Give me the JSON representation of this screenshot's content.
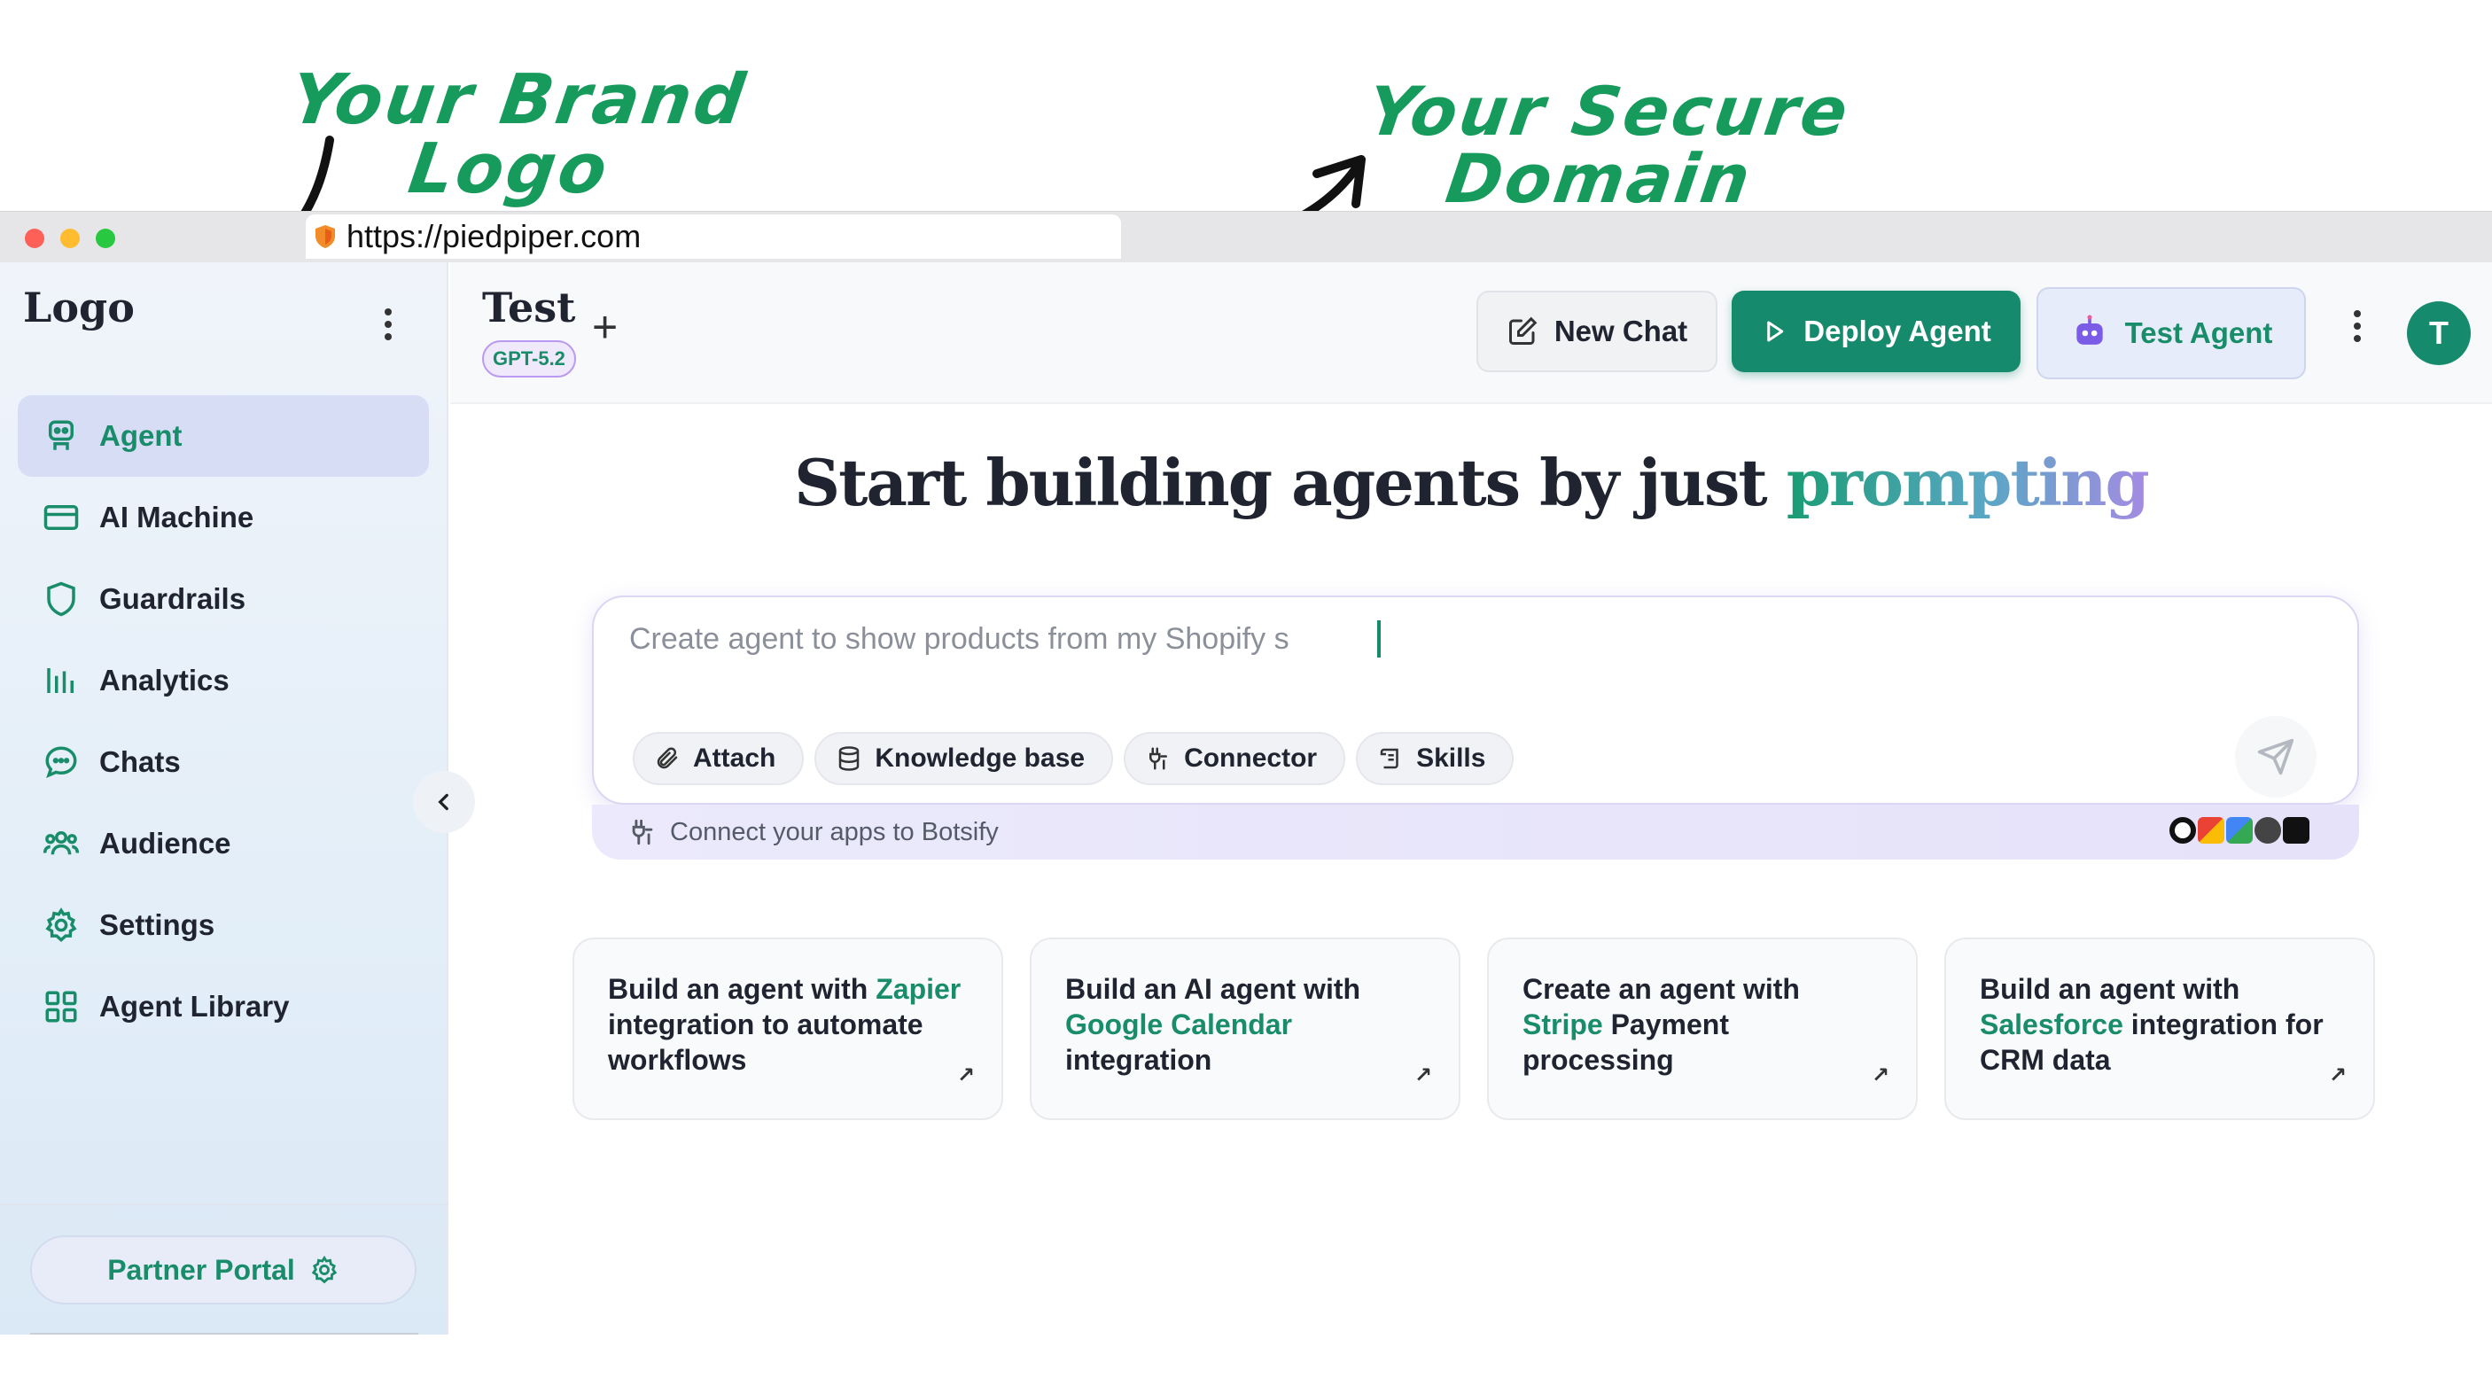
{
  "annotations": {
    "brand": [
      "Your Brand",
      "Logo"
    ],
    "domain": [
      "Your Secure",
      "Domain"
    ]
  },
  "browser": {
    "url": "https://piedpiper.com"
  },
  "sidebar": {
    "logo": "Logo",
    "items": [
      {
        "label": "Agent",
        "icon": "robot-icon",
        "active": true
      },
      {
        "label": "AI Machine",
        "icon": "card-icon",
        "active": false
      },
      {
        "label": "Guardrails",
        "icon": "shield-icon",
        "active": false
      },
      {
        "label": "Analytics",
        "icon": "bar-chart-icon",
        "active": false
      },
      {
        "label": "Chats",
        "icon": "chat-bubble-icon",
        "active": false
      },
      {
        "label": "Audience",
        "icon": "users-icon",
        "active": false
      },
      {
        "label": "Settings",
        "icon": "gear-icon",
        "active": false
      },
      {
        "label": "Agent Library",
        "icon": "grid-icon",
        "active": false
      }
    ],
    "partner_portal": "Partner Portal"
  },
  "header": {
    "title": "Test",
    "model": "GPT-5.2",
    "new_chat": "New Chat",
    "deploy": "Deploy Agent",
    "test": "Test Agent",
    "avatar": "T"
  },
  "main": {
    "headline_prefix": "Start building agents by just ",
    "headline_accent": "prompting",
    "prompt_value": "Create agent to show products from my Shopify s",
    "chips": [
      "Attach",
      "Knowledge base",
      "Connector",
      "Skills"
    ],
    "connect_text": "Connect your apps to Botsify",
    "suggestions": [
      {
        "before": "Build an agent with ",
        "highlight": "Zapier",
        "after": " integration to automate workflows"
      },
      {
        "before": "Build an AI agent with ",
        "highlight": "Google Calendar",
        "after": " integration"
      },
      {
        "before": "Create an agent with ",
        "highlight": "Stripe",
        "after": " Payment processing"
      },
      {
        "before": "Build an agent with ",
        "highlight": "Salesforce",
        "after": " integration for CRM data"
      }
    ]
  },
  "colors": {
    "accent": "#168a6c",
    "active_nav": "#d7ddf5",
    "annotation": "#179b5c"
  }
}
